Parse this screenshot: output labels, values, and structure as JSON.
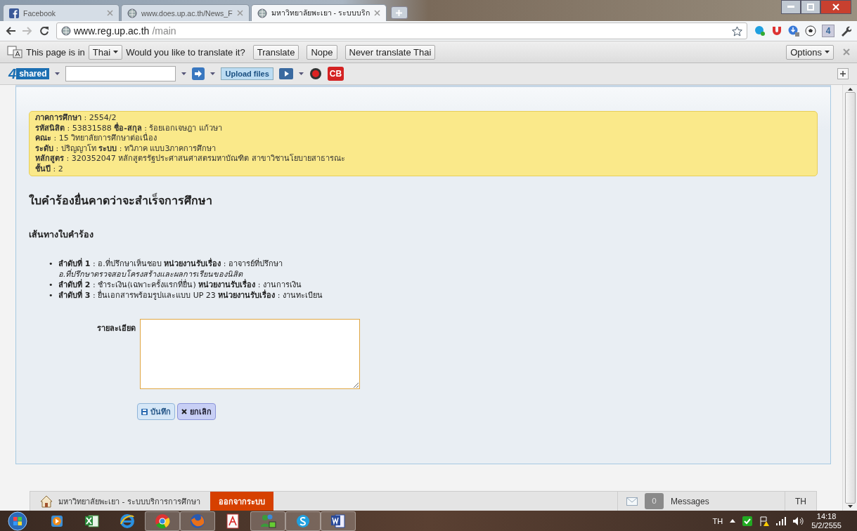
{
  "tabs": [
    {
      "title": "Facebook",
      "kind": "facebook",
      "selected": false
    },
    {
      "title": "www.does.up.ac.th/News_F",
      "kind": "web",
      "selected": false
    },
    {
      "title": "มหาวิทยาลัยพะเยา - ระบบบริก",
      "kind": "web",
      "selected": true
    }
  ],
  "address": {
    "host": "www.reg.up.ac.th",
    "path": "/main"
  },
  "translate_bar": {
    "lead": "This page is in",
    "language": "Thai",
    "question": "Would you like to translate it?",
    "buttons": [
      "Translate",
      "Nope",
      "Never translate Thai"
    ],
    "options": "Options"
  },
  "toolbar": {
    "brand_number": "4",
    "brand": "shared",
    "upload": "Upload files",
    "badge": "CB"
  },
  "extension_number": "4",
  "info": [
    "**ภาคการศึกษา** : 2554/2",
    "**รหัสนิสิต** : 53831588 **ชื่อ-สกุล** : ร้อยเอกเจษฎา แก้วษา",
    "**คณะ** : 15 วิทยาลัยการศึกษาต่อเนื่อง",
    "**ระดับ** : ปริญญาโท **ระบบ** : ทวิภาค แบบ3ภาคการศึกษา",
    "**หลักสูตร** : 320352047 หลักสูตรรัฐประศาสนศาสตรมหาบัณฑิต สาขาวิชานโยบายสาธารณะ",
    "**ชั้นปี** : 2"
  ],
  "heading": "ใบคำร้องยื่นคาดว่าจะสำเร็จการศึกษา",
  "subheading": "เส้นทางใบคำร้อง",
  "steps": [
    {
      "marker": "•",
      "text": "**ลำดับที่ 1** : อ.ที่ปรึกษาเห็นชอบ **หน่วยงานรับเรื่อง** : อาจารย์ที่ปรึกษา",
      "note": "อ.ที่ปรึกษาตรวจสอบโครงสร้างและผลการเรียนของนิสิต"
    },
    {
      "marker": "•",
      "text": "**ลำดับที่ 2** : ชำระเงิน(เฉพาะครั้งแรกที่ยื่น) **หน่วยงานรับเรื่อง** : งานการเงิน"
    },
    {
      "marker": "•",
      "text": "**ลำดับที่ 3** : ยื่นเอกสารพร้อมรูปและแบบ UP 23 **หน่วยงานรับเรื่อง** : งานทะเบียน"
    }
  ],
  "form": {
    "label": "รายละเอียด",
    "save": "บันทึก",
    "cancel": "ยกเลิก"
  },
  "footer": {
    "site": "มหาวิทยาลัยพะเยา - ระบบบริการการศึกษา",
    "logout": "ออกจากระบบ",
    "message_count": "0",
    "messages": "Messages",
    "language": "TH"
  },
  "taskbar": {
    "apps": [
      {
        "kind": "media",
        "selected": false
      },
      {
        "kind": "spreadsheet",
        "selected": false
      },
      {
        "kind": "ie",
        "selected": false
      },
      {
        "kind": "chrome",
        "selected": true
      },
      {
        "kind": "firefox",
        "selected": true
      },
      {
        "kind": "pdf",
        "selected": false
      },
      {
        "kind": "messenger",
        "selected": true
      },
      {
        "kind": "skype",
        "selected": true
      },
      {
        "kind": "word",
        "selected": true
      }
    ],
    "language": "TH",
    "time": "14:18",
    "date": "5/2/2555"
  }
}
